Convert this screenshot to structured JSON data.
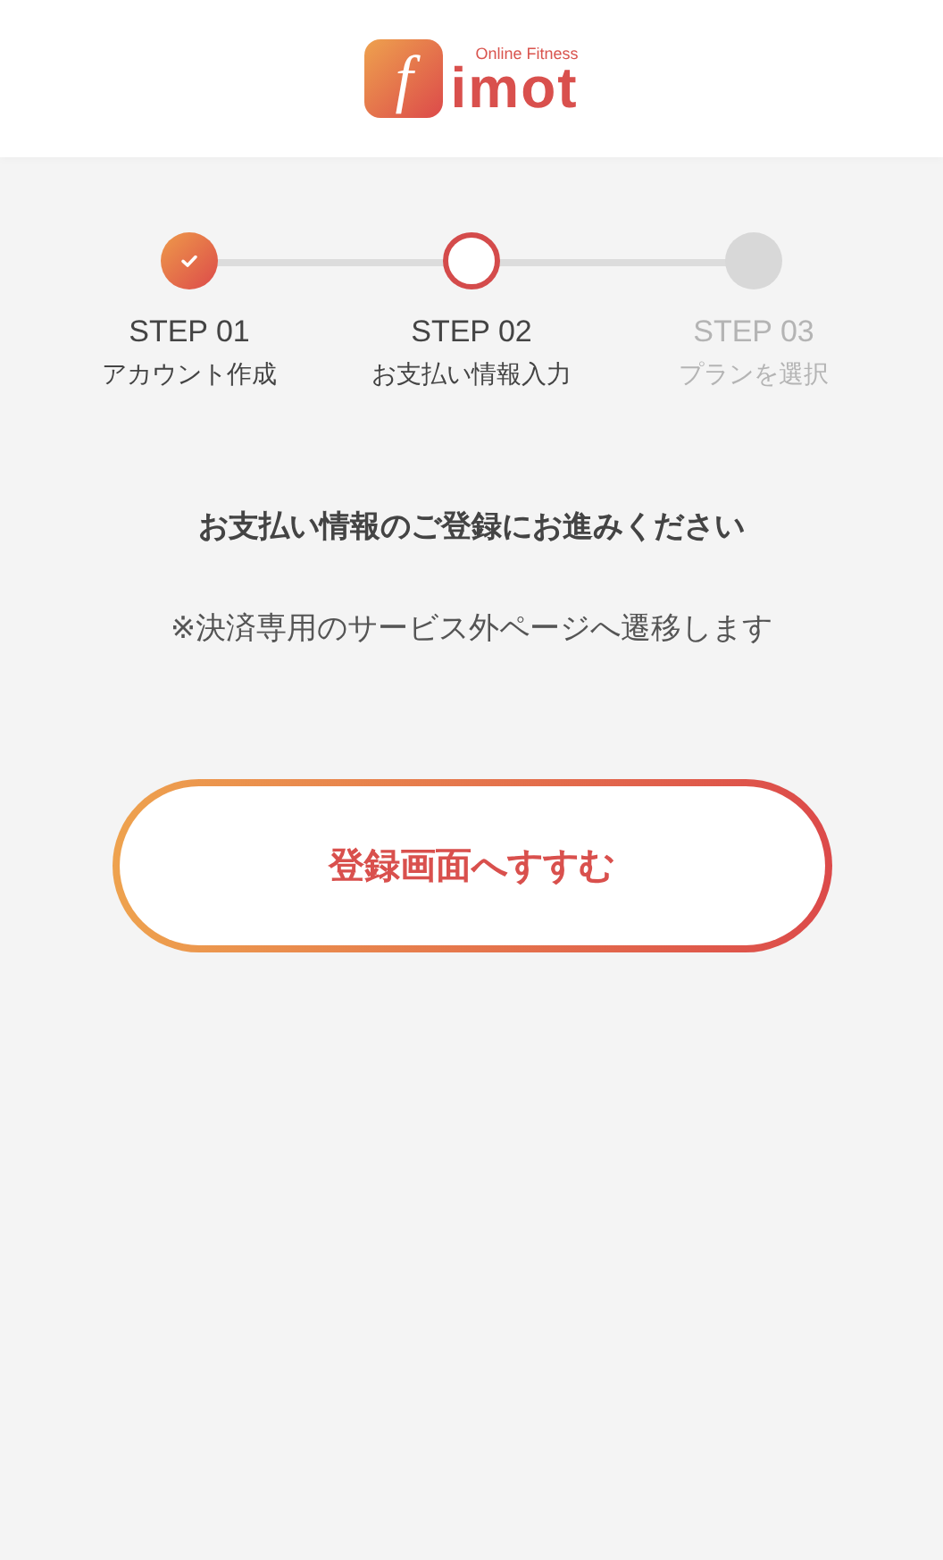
{
  "logo": {
    "mark": "f",
    "tagline": "Online Fitness",
    "name": "imot"
  },
  "steps": [
    {
      "step": "STEP 01",
      "label": "アカウント作成",
      "kind": "done"
    },
    {
      "step": "STEP 02",
      "label": "お支払い情報入力",
      "kind": "current"
    },
    {
      "step": "STEP 03",
      "label": "プランを選択",
      "kind": "pending"
    }
  ],
  "heading": "お支払い情報のご登録にお進みください",
  "note": "※決済専用のサービス外ページへ遷移します",
  "button": "登録画面へすすむ"
}
